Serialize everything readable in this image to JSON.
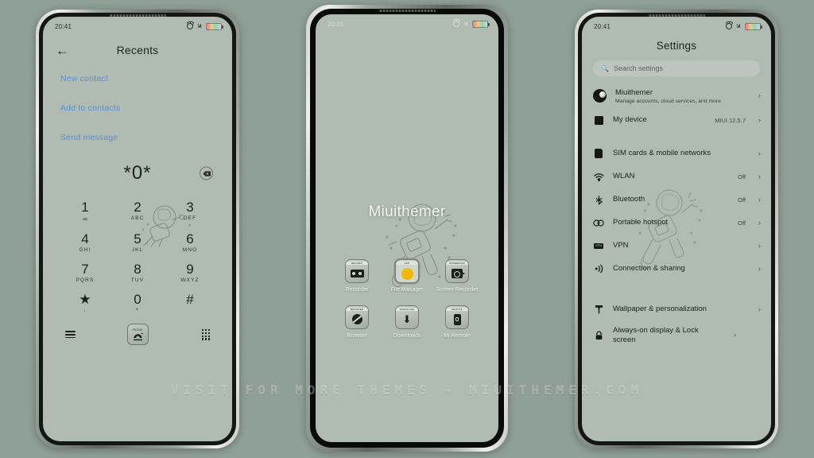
{
  "background_color": "#8fa096",
  "screen_color": "#b0bcb2",
  "accent_link_color": "#5b8fd6",
  "accent_yellow": "#f0b800",
  "watermark": "VISIT FOR MORE THEMES - MIUITHEMER.COM",
  "status_bar": {
    "time": "20:41",
    "alarm_icon": "alarm-icon",
    "airplane_icon": "airplane-mode-icon",
    "battery_icon": "battery-icon"
  },
  "phone1": {
    "back_icon": "back-arrow-icon",
    "title": "Recents",
    "links": [
      {
        "label": "New contact"
      },
      {
        "label": "Add to contacts"
      },
      {
        "label": "Send message"
      }
    ],
    "dialed_number": "*0*",
    "backspace_icon": "backspace-icon",
    "keys": [
      {
        "digit": "1",
        "letters": "∞"
      },
      {
        "digit": "2",
        "letters": "ABC"
      },
      {
        "digit": "3",
        "letters": "DEF"
      },
      {
        "digit": "4",
        "letters": "GHI"
      },
      {
        "digit": "5",
        "letters": "JKL"
      },
      {
        "digit": "6",
        "letters": "MNO"
      },
      {
        "digit": "7",
        "letters": "PQRS"
      },
      {
        "digit": "8",
        "letters": "TUV"
      },
      {
        "digit": "9",
        "letters": "WXYZ"
      },
      {
        "digit": "★",
        "letters": ","
      },
      {
        "digit": "0",
        "letters": "+"
      },
      {
        "digit": "#",
        "letters": ""
      }
    ],
    "bottom": {
      "menu_icon": "menu-icon",
      "call_button_caption": "PHONE",
      "call_icon": "call-icon",
      "keypad_icon": "keypad-icon"
    }
  },
  "phone2": {
    "home_title": "Miuithemer",
    "apps": [
      {
        "label": "Recorder",
        "badge": "RECORD",
        "icon": "recorder-icon",
        "selected": false
      },
      {
        "label": "File\nManager",
        "badge": "APP",
        "icon": "file-manager-icon",
        "selected": true
      },
      {
        "label": "Screen\nRecorder",
        "badge": "SCREENCAP",
        "icon": "screen-recorder-icon",
        "selected": false
      },
      {
        "label": "Browser",
        "badge": "BROWSER",
        "icon": "browser-icon",
        "selected": false
      },
      {
        "label": "Downloads",
        "badge": "DOWNLOAD",
        "icon": "downloads-icon",
        "selected": false
      },
      {
        "label": "Mi Remote",
        "badge": "REMOTE",
        "icon": "mi-remote-icon",
        "selected": false
      }
    ]
  },
  "phone3": {
    "title": "Settings",
    "search": {
      "placeholder": "Search settings",
      "icon": "search-icon"
    },
    "account": {
      "name": "Miuithemer",
      "subtitle": "Manage accounts, cloud services, and more",
      "avatar": "account-avatar"
    },
    "rows": [
      {
        "label": "My device",
        "value": "MIUI 12.5.7",
        "icon": "device-icon",
        "group": 0
      },
      {
        "label": "SIM cards & mobile networks",
        "value": "",
        "icon": "sim-card-icon",
        "group": 1
      },
      {
        "label": "WLAN",
        "value": "Off",
        "icon": "wifi-icon",
        "group": 1
      },
      {
        "label": "Bluetooth",
        "value": "Off",
        "icon": "bluetooth-icon",
        "group": 1
      },
      {
        "label": "Portable hotspot",
        "value": "Off",
        "icon": "hotspot-icon",
        "group": 1
      },
      {
        "label": "VPN",
        "value": "",
        "icon": "vpn-icon",
        "group": 1
      },
      {
        "label": "Connection & sharing",
        "value": "",
        "icon": "connection-sharing-icon",
        "group": 1
      },
      {
        "label": "Wallpaper & personalization",
        "value": "",
        "icon": "wallpaper-icon",
        "group": 2
      },
      {
        "label": "Always-on display & Lock screen",
        "value": "",
        "icon": "lock-icon",
        "group": 2
      }
    ],
    "chevron": "›"
  }
}
